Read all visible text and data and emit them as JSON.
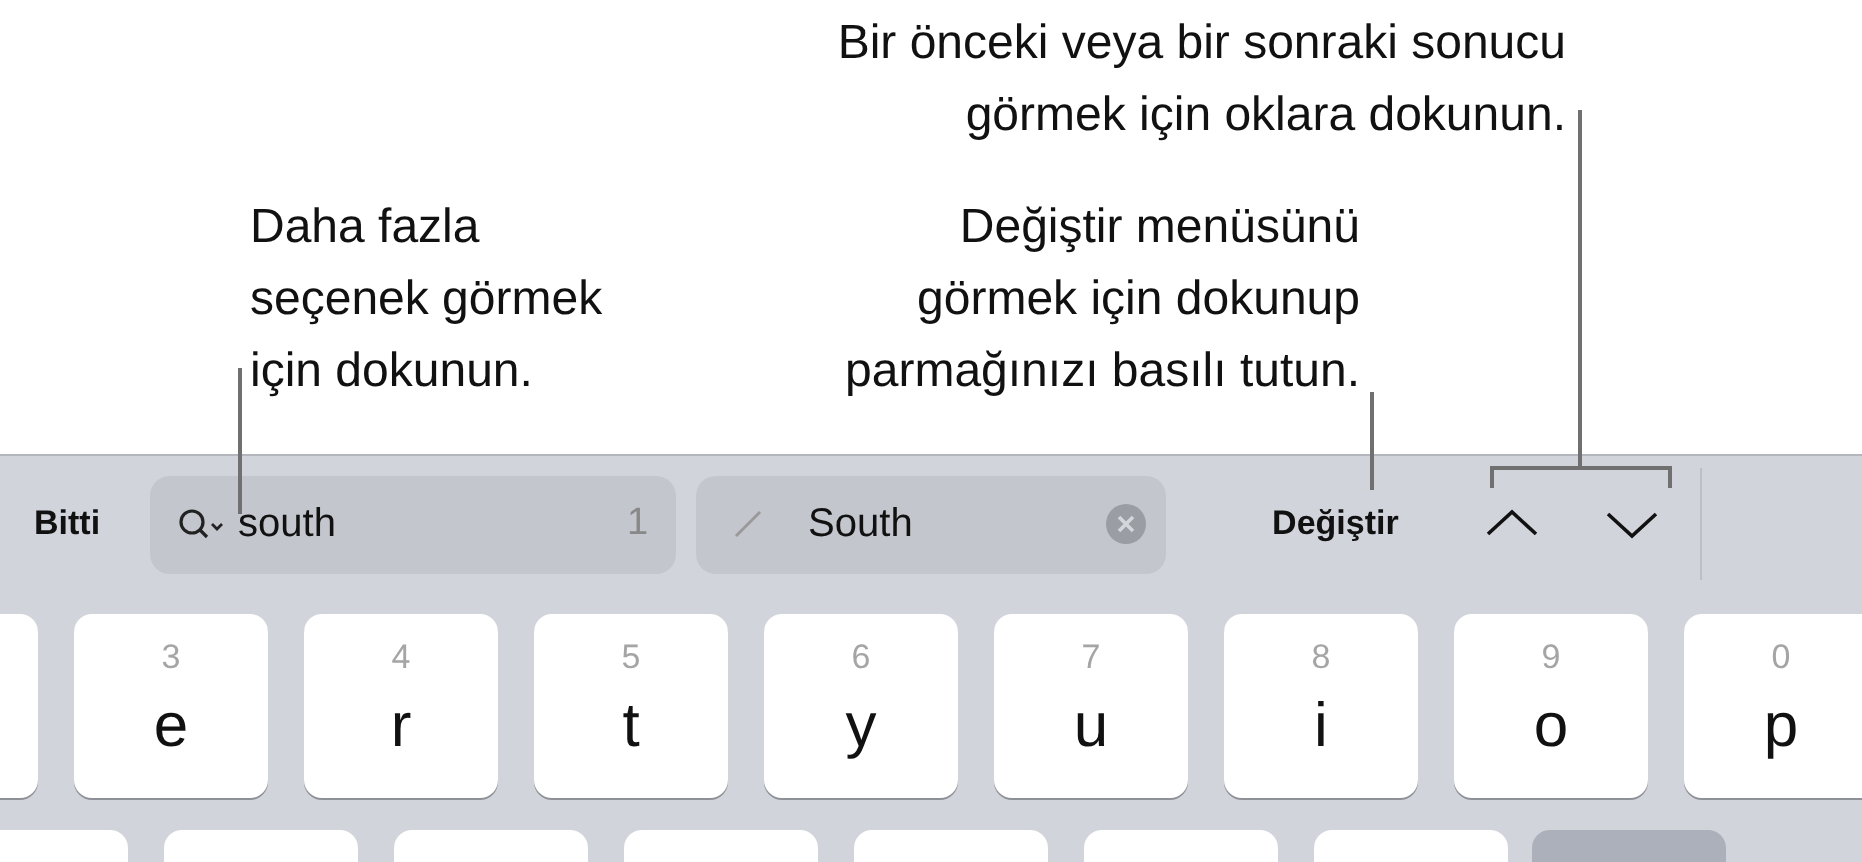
{
  "callouts": [
    {
      "kind": "arrows",
      "lines": [
        "Bir önceki veya bir sonraki sonucu",
        "görmek için oklara dokunun."
      ]
    },
    {
      "kind": "options",
      "lines": [
        "Daha fazla",
        "seçenek görmek",
        "için dokunun."
      ]
    },
    {
      "kind": "replace",
      "lines": [
        "Değiştir menüsünü",
        "görmek için dokunup",
        "parmağınızı basılı tutun."
      ]
    }
  ],
  "toolbar": {
    "done_button": "Bitti",
    "search_field": {
      "value": "south",
      "match_count": "1"
    },
    "replace_field": {
      "value": "South"
    },
    "replace_button": "Değiştir"
  },
  "keys": [
    {
      "hint": "3",
      "letter": "e"
    },
    {
      "hint": "4",
      "letter": "r"
    },
    {
      "hint": "5",
      "letter": "t"
    },
    {
      "hint": "6",
      "letter": "y"
    },
    {
      "hint": "7",
      "letter": "u"
    },
    {
      "hint": "8",
      "letter": "i"
    },
    {
      "hint": "9",
      "letter": "o"
    },
    {
      "hint": "0",
      "letter": "p"
    }
  ]
}
